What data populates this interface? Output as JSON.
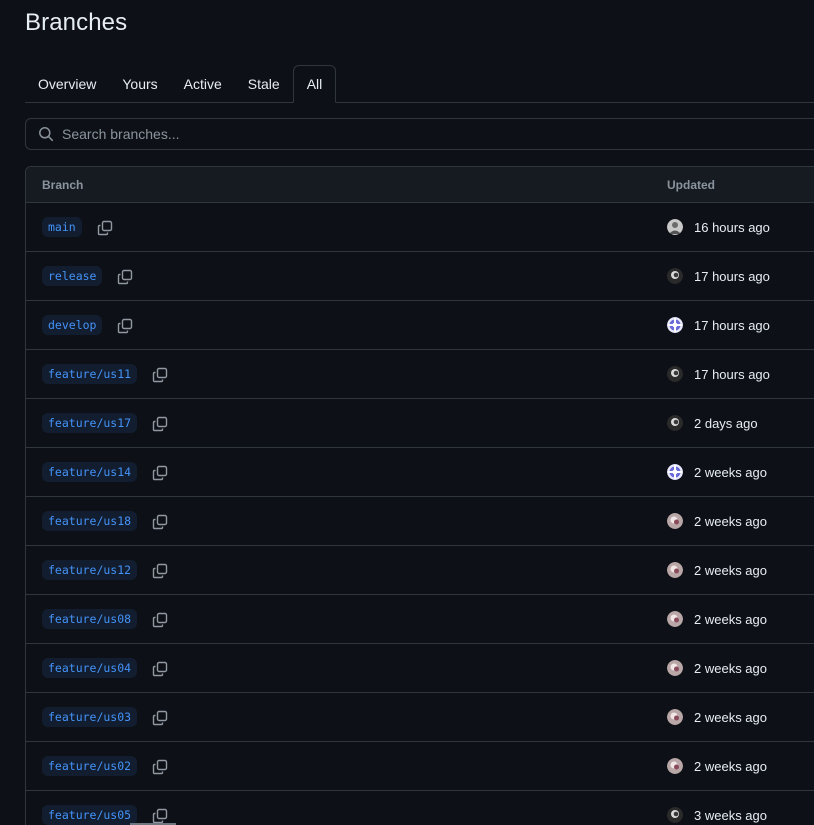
{
  "page": {
    "title": "Branches"
  },
  "tabs": [
    {
      "label": "Overview",
      "active": false
    },
    {
      "label": "Yours",
      "active": false
    },
    {
      "label": "Active",
      "active": false
    },
    {
      "label": "Stale",
      "active": false
    },
    {
      "label": "All",
      "active": true
    }
  ],
  "search": {
    "placeholder": "Search branches...",
    "value": "",
    "icon": "search-icon"
  },
  "table": {
    "headers": {
      "branch": "Branch",
      "updated": "Updated"
    },
    "rows": [
      {
        "branch": "main",
        "updated": "16 hours ago",
        "avatar": "avatar-a"
      },
      {
        "branch": "release",
        "updated": "17 hours ago",
        "avatar": "avatar-b"
      },
      {
        "branch": "develop",
        "updated": "17 hours ago",
        "avatar": "avatar-c"
      },
      {
        "branch": "feature/us11",
        "updated": "17 hours ago",
        "avatar": "avatar-b"
      },
      {
        "branch": "feature/us17",
        "updated": "2 days ago",
        "avatar": "avatar-b"
      },
      {
        "branch": "feature/us14",
        "updated": "2 weeks ago",
        "avatar": "avatar-c"
      },
      {
        "branch": "feature/us18",
        "updated": "2 weeks ago",
        "avatar": "avatar-d"
      },
      {
        "branch": "feature/us12",
        "updated": "2 weeks ago",
        "avatar": "avatar-d"
      },
      {
        "branch": "feature/us08",
        "updated": "2 weeks ago",
        "avatar": "avatar-d"
      },
      {
        "branch": "feature/us04",
        "updated": "2 weeks ago",
        "avatar": "avatar-d"
      },
      {
        "branch": "feature/us03",
        "updated": "2 weeks ago",
        "avatar": "avatar-d"
      },
      {
        "branch": "feature/us02",
        "updated": "2 weeks ago",
        "avatar": "avatar-d"
      },
      {
        "branch": "feature/us05",
        "updated": "3 weeks ago",
        "avatar": "avatar-b"
      }
    ]
  },
  "colors": {
    "background": "#0d1117",
    "border": "#30363d",
    "header_bg": "#161b22",
    "link_blue": "#4493f8",
    "pill_bg": "#121d2f",
    "muted_text": "#8b949e"
  }
}
